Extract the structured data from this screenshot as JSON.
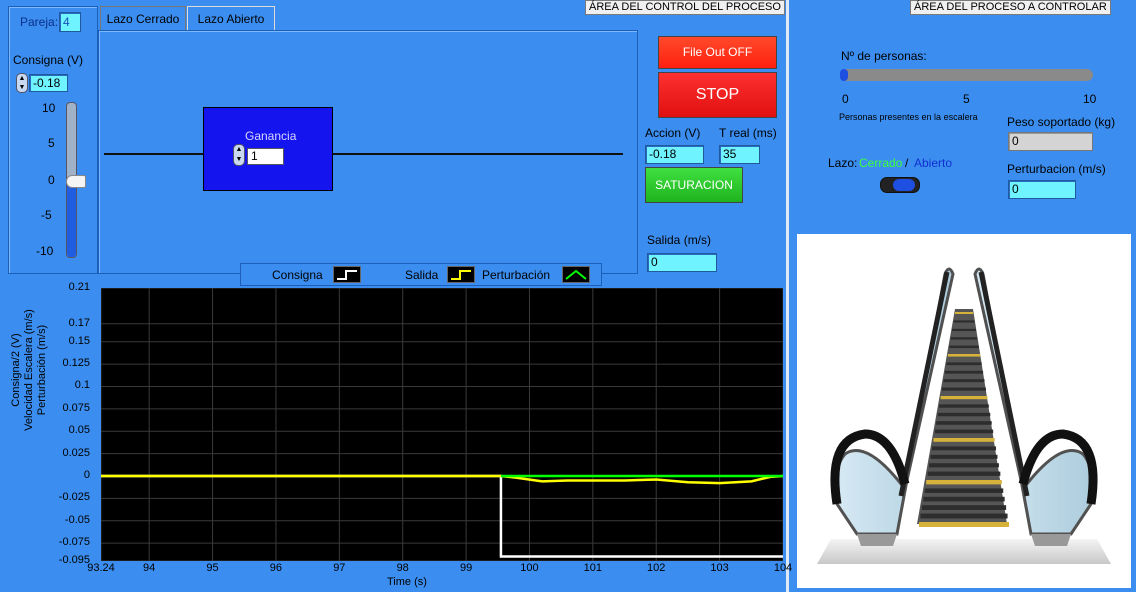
{
  "pair": {
    "label": "Pareja:",
    "value": "4"
  },
  "setpoint": {
    "label": "Consigna (V)",
    "value": "-0.18",
    "scale": [
      "10",
      "5",
      "0",
      "-5",
      "-10"
    ],
    "level": -0.18
  },
  "tabs": [
    {
      "label": "Lazo Cerrado"
    },
    {
      "label": "Lazo Abierto"
    }
  ],
  "control_area": {
    "title": "ÁREA DEL CONTROL DEL PROCESO"
  },
  "gain": {
    "label": "Ganancia",
    "value": "1"
  },
  "buttons": {
    "file_out": "File Out OFF",
    "stop": "STOP",
    "saturation": "SATURACION"
  },
  "action": {
    "label": "Accion (V)",
    "value": "-0.18"
  },
  "treal": {
    "label": "T real (ms)",
    "value": "35"
  },
  "output": {
    "label": "Salida (m/s)",
    "value": "0"
  },
  "legend": {
    "items": [
      {
        "label": "Consigna"
      },
      {
        "label": "Salida"
      },
      {
        "label": "Perturbación"
      }
    ]
  },
  "process_area": {
    "title": "ÁREA DEL PROCESO A CONTROLAR",
    "persons_label": "Nº de personas:",
    "persons_value": 0,
    "persons_scale": [
      "0",
      "5",
      "10"
    ],
    "persons_caption": "Personas presentes en la escalera",
    "weight_label": "Peso soportado (kg)",
    "weight_value": "0",
    "loop_label": "Lazo:",
    "loop_closed": "Cerrado",
    "loop_sep": "/",
    "loop_open": "Abierto",
    "disturbance_label": "Perturbacion (m/s)",
    "disturbance_value": "0"
  },
  "colors": {
    "background": "#3b8ef0",
    "consigna": "#ffffff",
    "salida": "#ffff00",
    "perturbacion": "#00ff00",
    "stop": "#ff1a1a",
    "saturacion": "#22cc22"
  },
  "chart_data": {
    "type": "line",
    "ylabel_lines": [
      "Consigna/2  (V)",
      "Velocidad Escalera (m/s)",
      "Perturbación (m/s)"
    ],
    "xlabel": "Time (s)",
    "xlim": [
      93.24,
      104
    ],
    "ylim": [
      -0.095,
      0.21
    ],
    "yticks": [
      "0.21",
      "0.17",
      "0.15",
      "0.125",
      "0.1",
      "0.075",
      "0.05",
      "0.025",
      "0",
      "-0.025",
      "-0.05",
      "-0.075",
      "-0.095"
    ],
    "xticks": [
      "93.24",
      "94",
      "95",
      "96",
      "97",
      "98",
      "99",
      "100",
      "101",
      "102",
      "103",
      "104"
    ],
    "series": [
      {
        "name": "Consigna",
        "color": "#ffffff",
        "x": [
          93.24,
          99.55,
          99.55,
          104
        ],
        "y": [
          0,
          0,
          -0.09,
          -0.09
        ]
      },
      {
        "name": "Salida",
        "color": "#ffff00",
        "x": [
          93.24,
          99.55,
          99.8,
          100.2,
          100.6,
          101.0,
          101.5,
          102.0,
          102.5,
          103.0,
          103.5,
          103.8,
          104
        ],
        "y": [
          0,
          0,
          -0.002,
          -0.006,
          -0.005,
          -0.005,
          -0.005,
          -0.004,
          -0.007,
          -0.008,
          -0.006,
          -0.001,
          0
        ]
      },
      {
        "name": "Perturbación",
        "color": "#00ff00",
        "x": [
          99.55,
          104
        ],
        "y": [
          0,
          0
        ]
      }
    ]
  }
}
